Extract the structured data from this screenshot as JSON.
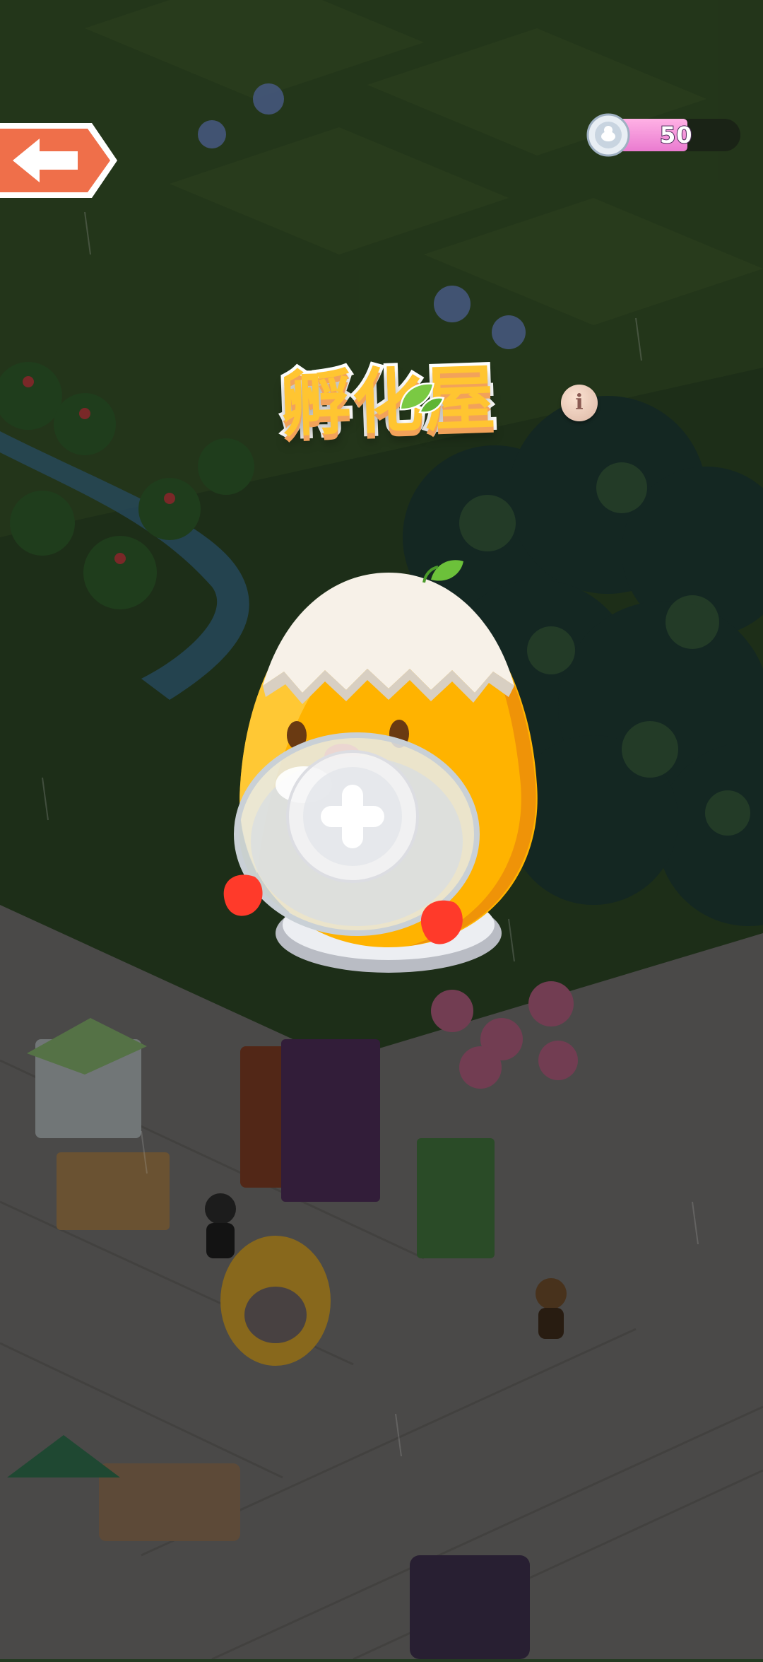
{
  "hud": {
    "currency": {
      "icon": "silver-coin-icon",
      "value": "50",
      "fill_fraction": 0.6
    }
  },
  "back_button": {
    "icon": "arrow-left-icon"
  },
  "title": {
    "text": "孵化屋"
  },
  "info_button": {
    "label": "i"
  },
  "incubator": {
    "icon": "chick-egg-incubator",
    "add_icon": "plus-icon"
  },
  "colors": {
    "back_button": "#ef6f4a",
    "title_fill": "#ffc531",
    "incubator_body": "#ffb300",
    "currency_fill": "#ea7bd0"
  }
}
